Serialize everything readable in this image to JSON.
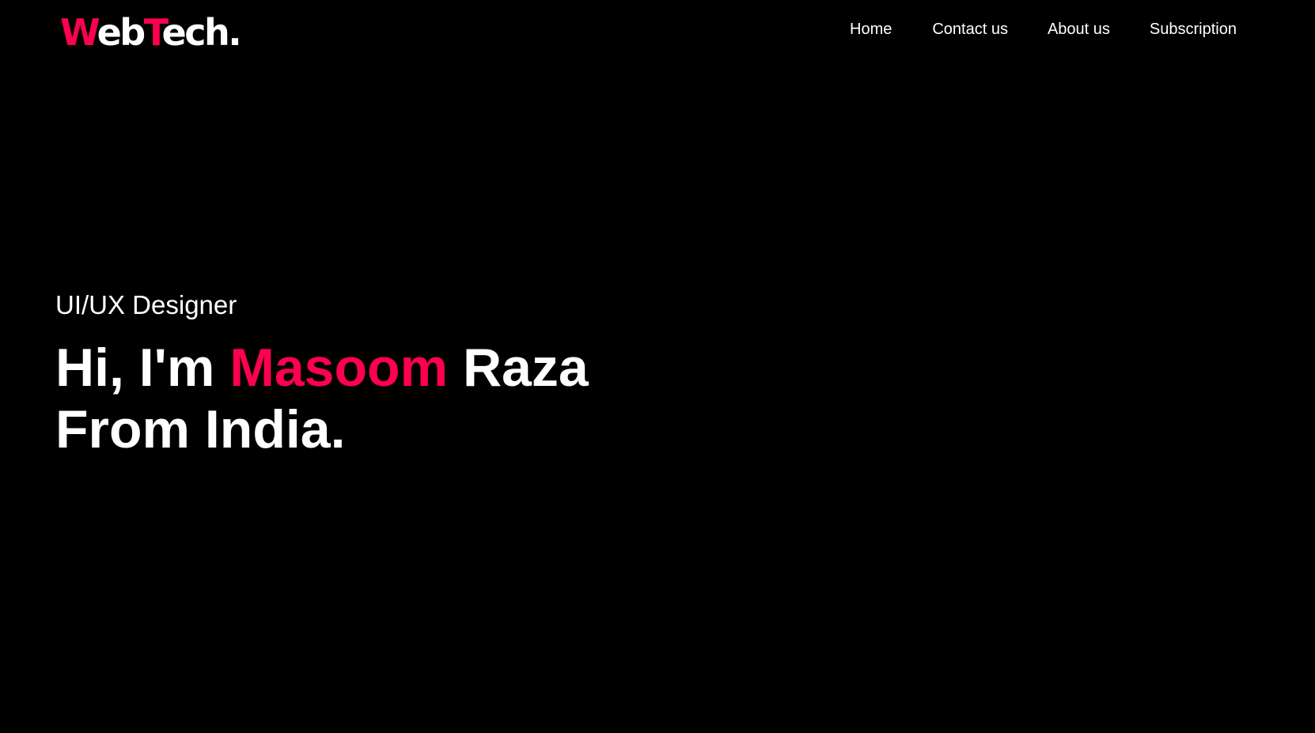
{
  "brand": {
    "logo_part1": "W",
    "logo_part2": "eb",
    "logo_part3": "T",
    "logo_part4": "ech.",
    "accent_color": "#ff004f"
  },
  "nav": {
    "items": [
      {
        "label": "Home"
      },
      {
        "label": "Contact us"
      },
      {
        "label": "About us"
      },
      {
        "label": "Subscription"
      }
    ]
  },
  "hero": {
    "role": "UI/UX Designer",
    "greeting": "Hi, I'm",
    "first_name": "Masoom",
    "last_name": "Raza",
    "line2": "From India."
  },
  "colors": {
    "background": "#000000",
    "text": "#ffffff",
    "accent": "#ff004f"
  }
}
